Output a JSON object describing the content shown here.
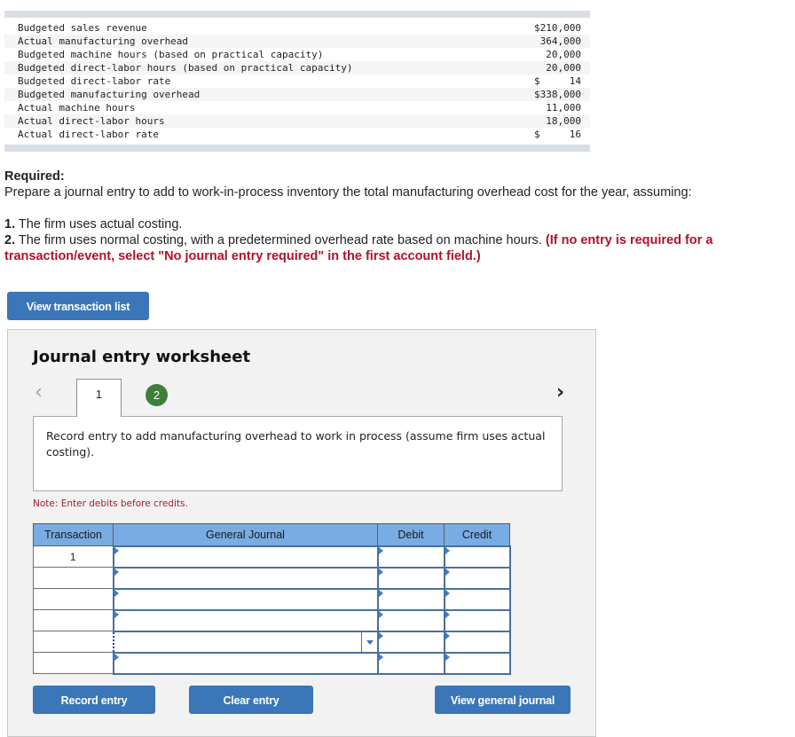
{
  "data_table": {
    "rows": [
      {
        "label": "Budgeted sales revenue",
        "value": "$210,000"
      },
      {
        "label": "Actual manufacturing overhead",
        "value": "364,000"
      },
      {
        "label": "Budgeted machine hours (based on practical capacity)",
        "value": "20,000"
      },
      {
        "label": "Budgeted direct-labor hours (based on practical capacity)",
        "value": "20,000"
      },
      {
        "label": "Budgeted direct-labor rate",
        "value": "$     14"
      },
      {
        "label": "Budgeted manufacturing overhead",
        "value": "$338,000"
      },
      {
        "label": "Actual machine hours",
        "value": "11,000"
      },
      {
        "label": "Actual direct-labor hours",
        "value": "18,000"
      },
      {
        "label": "Actual direct-labor rate",
        "value": "$     16"
      }
    ]
  },
  "required": {
    "heading": "Required:",
    "intro": "Prepare a journal entry to add to work-in-process inventory the total manufacturing overhead cost for the year, assuming:",
    "item1_num": "1.",
    "item1_text": " The firm uses actual costing.",
    "item2_num": "2.",
    "item2_text": " The firm uses normal costing, with a predetermined overhead rate based on machine hours. ",
    "item2_instruction": "(If no entry is required for a transaction/event, select \"No journal entry required\" in the first account field.)"
  },
  "buttons": {
    "view_transaction_list": "View transaction list",
    "record_entry": "Record entry",
    "clear_entry": "Clear entry",
    "view_general_journal": "View general journal"
  },
  "worksheet": {
    "title": "Journal entry worksheet",
    "prev_icon": "‹",
    "next_icon": "›",
    "tabs": [
      "1",
      "2"
    ],
    "description": "Record entry to add manufacturing overhead to work in process (assume firm uses actual costing).",
    "note": "Note: Enter debits before credits."
  },
  "journal": {
    "headers": {
      "transaction": "Transaction",
      "general_journal": "General Journal",
      "debit": "Debit",
      "credit": "Credit"
    },
    "rows": [
      {
        "transaction": "1",
        "account": "",
        "debit": "",
        "credit": ""
      },
      {
        "transaction": "",
        "account": "",
        "debit": "",
        "credit": ""
      },
      {
        "transaction": "",
        "account": "",
        "debit": "",
        "credit": ""
      },
      {
        "transaction": "",
        "account": "",
        "debit": "",
        "credit": ""
      },
      {
        "transaction": "",
        "account": "",
        "debit": "",
        "credit": ""
      },
      {
        "transaction": "",
        "account": "",
        "debit": "",
        "credit": ""
      }
    ]
  },
  "colors": {
    "button_blue": "#3a76b8",
    "header_blue": "#79ace2",
    "tab_green": "#3f7d3a",
    "instruction_red": "#b0112b"
  }
}
